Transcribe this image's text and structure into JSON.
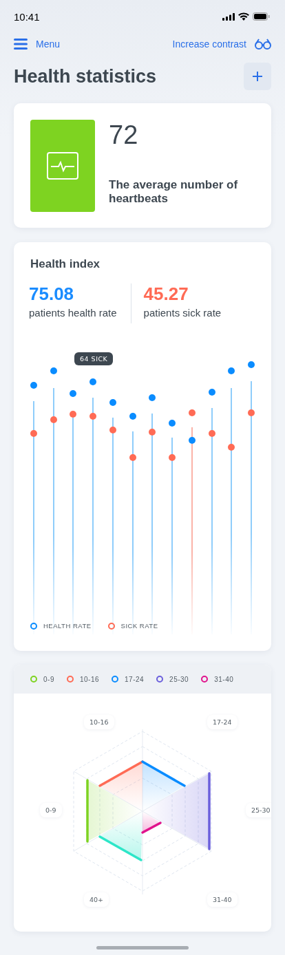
{
  "status_bar": {
    "time": "10:41"
  },
  "nav": {
    "menu_label": "Menu",
    "contrast_label": "Increase contrast"
  },
  "page": {
    "title": "Health statistics"
  },
  "heartbeat_card": {
    "value": "72",
    "caption": "The average number of heartbeats"
  },
  "health_index": {
    "title": "Health index",
    "stats": [
      {
        "value": "75.08",
        "label": "patients health rate",
        "color": "#1a8cff"
      },
      {
        "value": "45.27",
        "label": "patients sick rate",
        "color": "#ff6b55"
      }
    ],
    "tooltip": "64 SICK",
    "legend": [
      {
        "label": "HEALTH RATE",
        "color": "#0a8cff"
      },
      {
        "label": "SICK RATE",
        "color": "#ff6b55"
      }
    ]
  },
  "age_groups": {
    "legend": [
      {
        "label": "0-9",
        "color": "#7ed321"
      },
      {
        "label": "10-16",
        "color": "#ff6b55"
      },
      {
        "label": "17-24",
        "color": "#0a8cff"
      },
      {
        "label": "25-30",
        "color": "#6b5fdc"
      },
      {
        "label": "31-40",
        "color": "#e0138c"
      }
    ],
    "axis_labels": [
      "10-16",
      "17-24",
      "0-9",
      "25-30",
      "40+",
      "31-40"
    ]
  }
}
